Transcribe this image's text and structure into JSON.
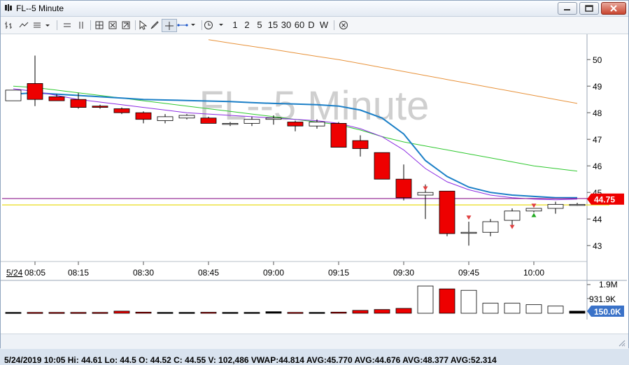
{
  "window": {
    "title": "FL--5 Minute"
  },
  "toolbar": {
    "intervals": [
      "1",
      "2",
      "5",
      "15",
      "30",
      "60",
      "D",
      "W"
    ]
  },
  "chart": {
    "watermark": "FL--5 Minute",
    "date_label": "5/24",
    "last_price_label": "44.75",
    "volume_last_label": "150.0K",
    "volume_labels": [
      "1.9M",
      "931.9K"
    ]
  },
  "status": {
    "text": "5/24/2019 10:05  Hi: 44.61  Lo: 44.5  O: 44.52  C: 44.55  V: 102,486  VWAP:44.814  AVG:45.770  AVG:44.676  AVG:48.377  AVG:52.314"
  },
  "colors": {
    "down": "#ee0000",
    "up": "#ffffff",
    "ma_orange": "#e8923a",
    "ma_green": "#2fc82f",
    "ma_blue": "#1b7fc7",
    "ma_purple": "#8b2be2",
    "line_purple": "#8e1a8e",
    "line_yellow": "#e6d800",
    "price_tag": "#ee0000",
    "volume_tag": "#3a72c8"
  },
  "chart_data": {
    "type": "candlestick",
    "x": [
      "08:00",
      "08:05",
      "08:10",
      "08:15",
      "08:20",
      "08:25",
      "08:30",
      "08:35",
      "08:40",
      "08:45",
      "08:50",
      "08:55",
      "09:00",
      "09:05",
      "09:10",
      "09:15",
      "09:20",
      "09:25",
      "09:30",
      "09:35",
      "09:40",
      "09:45",
      "09:50",
      "09:55",
      "10:00",
      "10:05"
    ],
    "x_tick_labels": [
      "08:05",
      "08:15",
      "08:30",
      "08:45",
      "09:00",
      "09:15",
      "09:30",
      "09:45",
      "10:00"
    ],
    "y_ticks": [
      43,
      44,
      45,
      46,
      47,
      48,
      49,
      50
    ],
    "ylim": [
      42.4,
      50.9
    ],
    "candles": [
      {
        "o": 48.45,
        "h": 48.85,
        "l": 48.45,
        "c": 48.85
      },
      {
        "o": 49.1,
        "h": 50.15,
        "l": 48.25,
        "c": 48.5
      },
      {
        "o": 48.6,
        "h": 48.7,
        "l": 48.45,
        "c": 48.45
      },
      {
        "o": 48.5,
        "h": 48.75,
        "l": 48.15,
        "c": 48.2
      },
      {
        "o": 48.25,
        "h": 48.3,
        "l": 48.15,
        "c": 48.2
      },
      {
        "o": 48.15,
        "h": 48.2,
        "l": 47.95,
        "c": 48.0
      },
      {
        "o": 48.0,
        "h": 48.05,
        "l": 47.6,
        "c": 47.75
      },
      {
        "o": 47.7,
        "h": 47.95,
        "l": 47.6,
        "c": 47.85
      },
      {
        "o": 47.8,
        "h": 47.95,
        "l": 47.75,
        "c": 47.9
      },
      {
        "o": 47.8,
        "h": 47.85,
        "l": 47.6,
        "c": 47.6
      },
      {
        "o": 47.6,
        "h": 47.65,
        "l": 47.5,
        "c": 47.6
      },
      {
        "o": 47.6,
        "h": 47.85,
        "l": 47.5,
        "c": 47.75
      },
      {
        "o": 47.75,
        "h": 47.9,
        "l": 47.55,
        "c": 47.8
      },
      {
        "o": 47.65,
        "h": 47.7,
        "l": 47.3,
        "c": 47.5
      },
      {
        "o": 47.5,
        "h": 47.75,
        "l": 47.4,
        "c": 47.65
      },
      {
        "o": 47.6,
        "h": 47.65,
        "l": 46.7,
        "c": 46.7
      },
      {
        "o": 46.95,
        "h": 47.15,
        "l": 46.35,
        "c": 46.65
      },
      {
        "o": 46.5,
        "h": 46.5,
        "l": 45.5,
        "c": 45.5
      },
      {
        "o": 45.5,
        "h": 46.05,
        "l": 44.7,
        "c": 44.8
      },
      {
        "o": 44.9,
        "h": 45.3,
        "l": 44.0,
        "c": 45.0
      },
      {
        "o": 45.05,
        "h": 45.05,
        "l": 43.35,
        "c": 43.45
      },
      {
        "o": 43.5,
        "h": 43.9,
        "l": 43.0,
        "c": 43.5
      },
      {
        "o": 43.5,
        "h": 44.0,
        "l": 43.35,
        "c": 43.9
      },
      {
        "o": 43.95,
        "h": 44.4,
        "l": 43.75,
        "c": 44.3
      },
      {
        "o": 44.3,
        "h": 44.4,
        "l": 44.25,
        "c": 44.4
      },
      {
        "o": 44.4,
        "h": 44.65,
        "l": 44.2,
        "c": 44.55
      },
      {
        "o": 44.52,
        "h": 44.61,
        "l": 44.5,
        "c": 44.55
      }
    ],
    "volume": [
      60000,
      60000,
      60000,
      60000,
      60000,
      150000,
      80000,
      60000,
      60000,
      70000,
      60000,
      60000,
      110000,
      60000,
      60000,
      80000,
      200000,
      260000,
      340000,
      1900000,
      1700000,
      1600000,
      700000,
      700000,
      600000,
      500000,
      150000
    ],
    "volume_ylim": [
      0,
      2000000
    ],
    "ma_series": [
      {
        "color": "orange",
        "values": [
          null,
          null,
          null,
          null,
          null,
          null,
          null,
          null,
          null,
          50.75,
          50.62,
          50.5,
          50.38,
          50.25,
          50.12,
          50.0,
          49.85,
          49.7,
          49.55,
          49.4,
          49.25,
          49.1,
          48.95,
          48.8,
          48.65,
          48.5,
          48.35
        ]
      },
      {
        "color": "green",
        "values": [
          49.0,
          48.95,
          48.85,
          48.75,
          48.65,
          48.55,
          48.45,
          48.35,
          48.25,
          48.15,
          48.05,
          47.95,
          47.85,
          47.75,
          47.65,
          47.55,
          47.35,
          47.1,
          46.9,
          46.75,
          46.6,
          46.45,
          46.3,
          46.15,
          46.0,
          45.9,
          45.8
        ]
      },
      {
        "color": "blue",
        "values": [
          48.7,
          48.75,
          48.7,
          48.65,
          48.6,
          48.55,
          48.5,
          48.48,
          48.46,
          48.44,
          48.42,
          48.38,
          48.35,
          48.33,
          48.3,
          48.25,
          48.1,
          47.8,
          47.2,
          46.2,
          45.6,
          45.2,
          45.0,
          44.9,
          44.85,
          44.8,
          44.8
        ]
      },
      {
        "color": "purple",
        "values": [
          48.9,
          48.8,
          48.65,
          48.5,
          48.4,
          48.3,
          48.2,
          48.1,
          48.0,
          47.95,
          47.9,
          47.85,
          47.8,
          47.75,
          47.7,
          47.6,
          47.4,
          47.1,
          46.6,
          45.9,
          45.4,
          45.1,
          44.9,
          44.8,
          44.75,
          44.72,
          44.75
        ]
      }
    ],
    "h_lines": [
      {
        "value": 44.77,
        "color": "purple"
      },
      {
        "value": 44.53,
        "color": "yellow"
      }
    ],
    "markers": [
      {
        "i": 19,
        "value": 45.15,
        "dir": "down",
        "color": "#e04040"
      },
      {
        "i": 21,
        "value": 44.05,
        "dir": "down",
        "color": "#e04040"
      },
      {
        "i": 23,
        "value": 43.7,
        "dir": "down",
        "color": "#e04040"
      },
      {
        "i": 24,
        "value": 44.15,
        "dir": "up",
        "color": "#22aa22"
      },
      {
        "i": 24,
        "value": 44.5,
        "dir": "down",
        "color": "#e04040"
      }
    ]
  }
}
